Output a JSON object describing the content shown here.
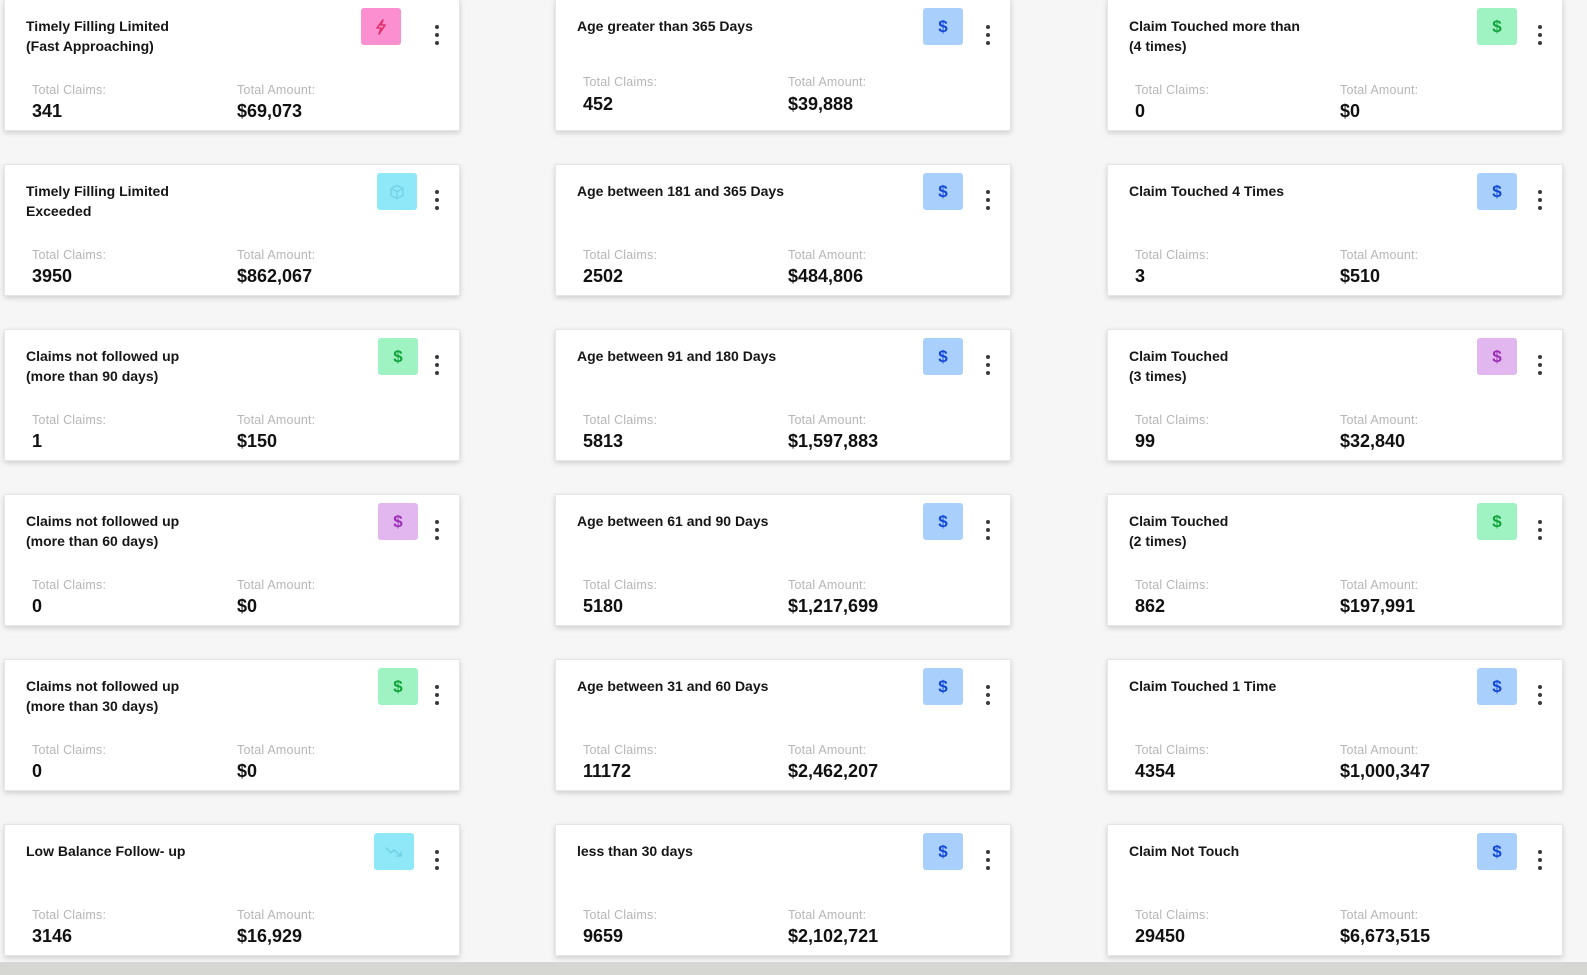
{
  "labels": {
    "claims": "Total Claims:",
    "amount": "Total Amount:"
  },
  "colors": {
    "pink": "#fb8fcf",
    "pink_icon": "#e0336b",
    "cyan": "#8fe8f7",
    "cyan_icon": "#6fcfe3",
    "green": "#9ff2c2",
    "green_icon": "#11a33c",
    "purple": "#e2b7ef",
    "purple_icon": "#9b2fb5",
    "blue": "#a9cffc",
    "blue_icon": "#1248d6"
  },
  "columns": [
    {
      "cards": [
        {
          "title": "Timely Filling Limited\n(Fast Approaching)",
          "claims": "341",
          "amount": "$69,073",
          "icon": "lightning-icon",
          "color": "pink"
        },
        {
          "title": "Timely Filling Limited\nExceeded",
          "claims": "3950",
          "amount": "$862,067",
          "icon": "box-icon",
          "color": "cyan"
        },
        {
          "title": "Claims not followed up\n(more than 90 days)",
          "claims": "1",
          "amount": "$150",
          "icon": "dollar-icon",
          "color": "green"
        },
        {
          "title": "Claims not followed up\n(more than 60 days)",
          "claims": "0",
          "amount": "$0",
          "icon": "dollar-icon",
          "color": "purple"
        },
        {
          "title": "Claims not followed up\n(more than 30 days)",
          "claims": "0",
          "amount": "$0",
          "icon": "dollar-icon",
          "color": "green"
        },
        {
          "title": "Low Balance Follow- up",
          "claims": "3146",
          "amount": "$16,929",
          "icon": "trend-down-icon",
          "color": "cyan"
        }
      ]
    },
    {
      "cards": [
        {
          "title": "Age greater than 365 Days",
          "claims": "452",
          "amount": "$39,888",
          "icon": "dollar-icon",
          "color": "blue"
        },
        {
          "title": "Age between 181 and 365 Days",
          "claims": "2502",
          "amount": "$484,806",
          "icon": "dollar-icon",
          "color": "blue"
        },
        {
          "title": "Age between 91 and 180 Days",
          "claims": "5813",
          "amount": "$1,597,883",
          "icon": "dollar-icon",
          "color": "blue"
        },
        {
          "title": "Age between 61 and 90 Days",
          "claims": "5180",
          "amount": "$1,217,699",
          "icon": "dollar-icon",
          "color": "blue"
        },
        {
          "title": "Age between 31 and 60 Days",
          "claims": "11172",
          "amount": "$2,462,207",
          "icon": "dollar-icon",
          "color": "blue"
        },
        {
          "title": "less than 30 days",
          "claims": "9659",
          "amount": "$2,102,721",
          "icon": "dollar-icon",
          "color": "blue"
        }
      ]
    },
    {
      "cards": [
        {
          "title": "Claim Touched more than\n(4 times)",
          "claims": "0",
          "amount": "$0",
          "icon": "dollar-icon",
          "color": "green"
        },
        {
          "title": "Claim Touched 4 Times",
          "claims": "3",
          "amount": "$510",
          "icon": "dollar-icon",
          "color": "blue"
        },
        {
          "title": "Claim Touched\n(3 times)",
          "claims": "99",
          "amount": "$32,840",
          "icon": "dollar-icon",
          "color": "purple"
        },
        {
          "title": "Claim Touched\n(2 times)",
          "claims": "862",
          "amount": "$197,991",
          "icon": "dollar-icon",
          "color": "green"
        },
        {
          "title": "Claim Touched 1 Time",
          "claims": "4354",
          "amount": "$1,000,347",
          "icon": "dollar-icon",
          "color": "blue"
        },
        {
          "title": "Claim Not Touch",
          "claims": "29450",
          "amount": "$6,673,515",
          "icon": "dollar-icon",
          "color": "blue"
        }
      ]
    }
  ]
}
